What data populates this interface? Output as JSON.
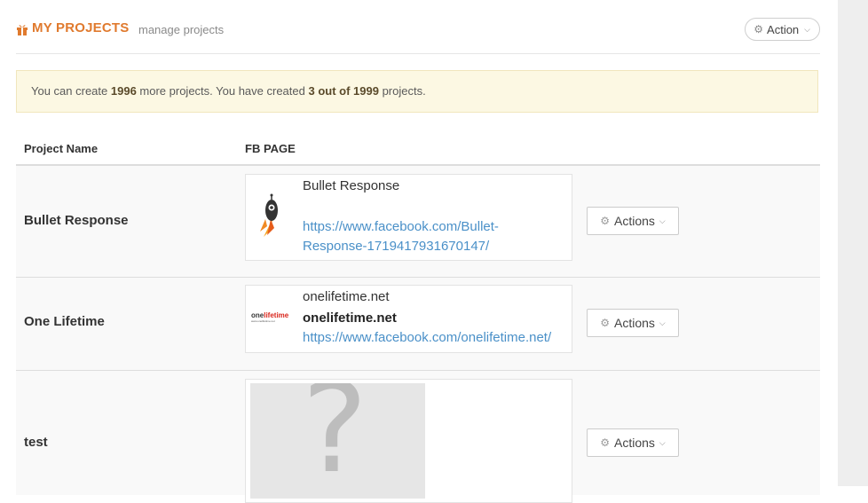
{
  "header": {
    "title": "MY PROJECTS",
    "subtitle": "manage projects",
    "action_label": "Action",
    "icon": "gift-icon"
  },
  "alert": {
    "text_1": "You can create ",
    "remaining": "1996",
    "text_2": " more projects. You have created ",
    "created": "3 out of 1999",
    "text_3": " projects."
  },
  "table": {
    "columns": [
      "Project Name",
      "FB PAGE"
    ],
    "rows": [
      {
        "name": "Bullet Response",
        "fb_title": "Bullet Response",
        "fb_bold": "",
        "fb_link_line1": "https://www.facebook.com/Bullet-",
        "fb_link_line2": "Response-1719417931670147/",
        "actions_label": "Actions",
        "thumb": "rocket-icon"
      },
      {
        "name": "One Lifetime",
        "fb_title": "onelifetime.net",
        "fb_bold": "onelifetime.net",
        "fb_link_line1": "https://www.facebook.com/onelifetime.net/",
        "fb_link_line2": "",
        "actions_label": "Actions",
        "thumb": "onelifetime-logo",
        "logo_text_a": "one",
        "logo_text_b": "lifetime",
        "logo_sub": "www.onelifetime.net"
      },
      {
        "name": "test",
        "fb_title": "",
        "fb_bold": "",
        "fb_link_line1": "",
        "fb_link_line2": "",
        "actions_label": "Actions",
        "thumb": "question-mark-placeholder",
        "placeholder_glyph": "?"
      }
    ]
  },
  "colors": {
    "title": "#e07a2e",
    "link": "#4a90c8",
    "alert_bg": "#fcf8e3",
    "row_bg": "#f9f9f9"
  }
}
